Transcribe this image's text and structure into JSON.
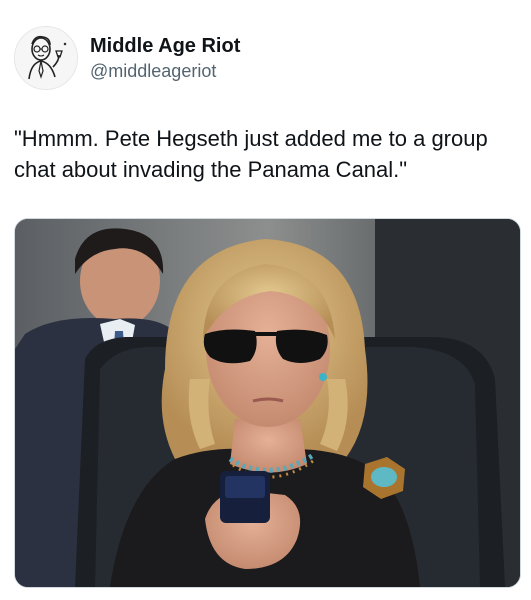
{
  "author": {
    "display_name": "Middle Age Riot",
    "handle": "@middleageriot",
    "avatar_icon": "sketch-man-avatar-icon"
  },
  "tweet": {
    "text": "\"Hmmm. Pete Hegseth just added me to a group chat about invading the Panama Canal.\""
  },
  "media": {
    "kind": "photo",
    "icon": "photo-woman-sunglasses-phone"
  },
  "colors": {
    "text_primary": "#0f1419",
    "text_secondary": "#536471",
    "border": "#cfd9de"
  }
}
